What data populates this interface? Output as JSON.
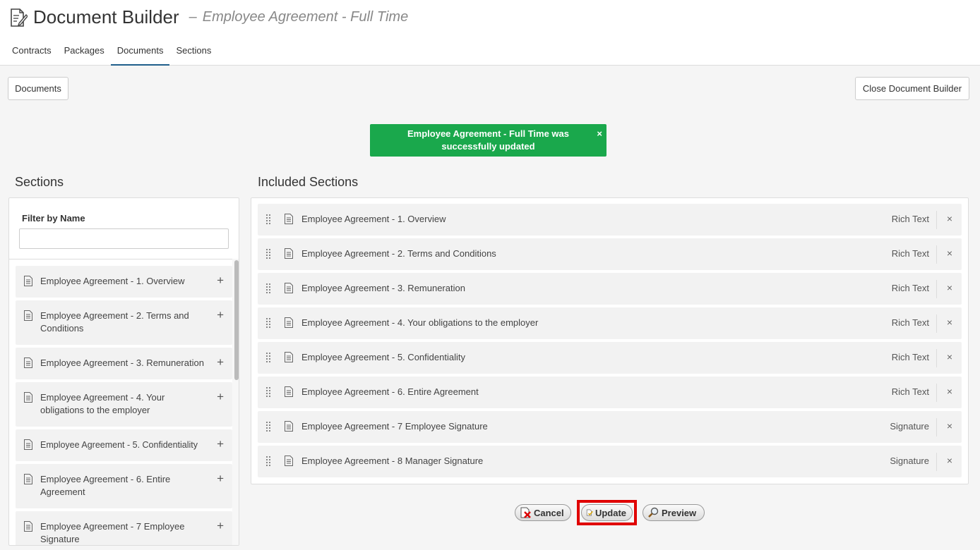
{
  "header": {
    "title": "Document Builder",
    "separator": "–",
    "subtitle": "Employee Agreement - Full Time",
    "tabs": [
      {
        "label": "Contracts",
        "active": false
      },
      {
        "label": "Packages",
        "active": false
      },
      {
        "label": "Documents",
        "active": true
      },
      {
        "label": "Sections",
        "active": false
      }
    ]
  },
  "toolbar": {
    "documents_label": "Documents",
    "close_label": "Close Document Builder"
  },
  "toast": {
    "message": "Employee Agreement - Full Time was successfully updated",
    "close": "×",
    "color": "#1aa84c"
  },
  "sections_panel": {
    "heading": "Sections",
    "filter_label": "Filter by Name",
    "filter_value": "",
    "add_symbol": "+",
    "items": [
      "Employee Agreement - 1. Overview",
      "Employee Agreement - 2. Terms and Conditions",
      "Employee Agreement - 3. Remuneration",
      "Employee Agreement - 4. Your obligations to the employer",
      "Employee Agreement - 5. Confidentiality",
      "Employee Agreement - 6. Entire Agreement",
      "Employee Agreement - 7 Employee Signature"
    ]
  },
  "included_panel": {
    "heading": "Included Sections",
    "remove_symbol": "×",
    "rows": [
      {
        "label": "Employee Agreement - 1. Overview",
        "type": "Rich Text"
      },
      {
        "label": "Employee Agreement - 2. Terms and Conditions",
        "type": "Rich Text"
      },
      {
        "label": "Employee Agreement - 3. Remuneration",
        "type": "Rich Text"
      },
      {
        "label": "Employee Agreement - 4. Your obligations to the employer",
        "type": "Rich Text"
      },
      {
        "label": "Employee Agreement - 5. Confidentiality",
        "type": "Rich Text"
      },
      {
        "label": "Employee Agreement - 6. Entire Agreement",
        "type": "Rich Text"
      },
      {
        "label": "Employee Agreement - 7 Employee Signature",
        "type": "Signature"
      },
      {
        "label": "Employee Agreement - 8 Manager Signature",
        "type": "Signature"
      }
    ]
  },
  "actions": {
    "cancel_label": "Cancel",
    "update_label": "Update",
    "preview_label": "Preview",
    "highlight_color": "#e00000"
  },
  "icons": {
    "title": "document-edit-icon",
    "section": "document-icon",
    "grip": "drag-handle-icon",
    "cancel": "cancel-doc-icon",
    "update": "update-doc-icon",
    "preview": "magnifier-icon"
  }
}
